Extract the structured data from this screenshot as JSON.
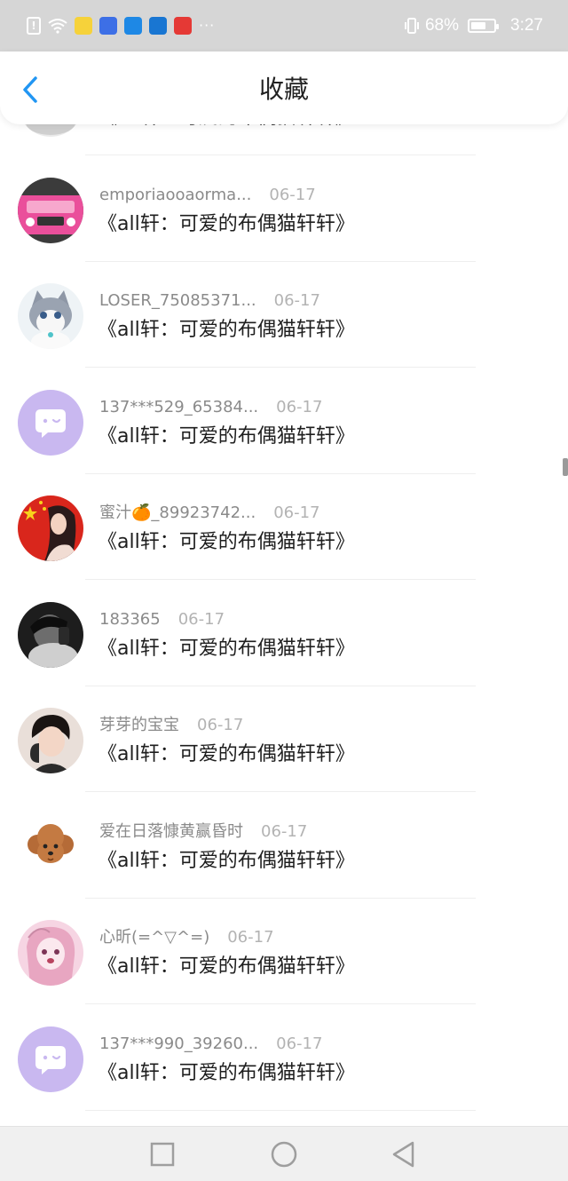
{
  "status_bar": {
    "battery_percent": "68%",
    "battery_level": 0.68,
    "time": "3:27",
    "more": "···",
    "icons": [
      "alert-icon",
      "wifi-icon",
      "app-icon-bee",
      "app-icon-baidu",
      "app-icon-quan",
      "app-icon-wifi-key",
      "app-icon-red",
      "vibrate-icon",
      "battery-icon"
    ]
  },
  "header": {
    "title": "收藏",
    "back_icon": "chevron-left-icon"
  },
  "items": [
    {
      "user": "",
      "date": "",
      "message": "《all轩：可爱的布偶猫轩轩》",
      "avatar": "partial-avatar"
    },
    {
      "user": "emporiaooaorma...",
      "date": "06-17",
      "message": "《all轩：可爱的布偶猫轩轩》",
      "avatar": "pink-car-avatar"
    },
    {
      "user": "LOSER_75085371...",
      "date": "06-17",
      "message": "《all轩：可爱的布偶猫轩轩》",
      "avatar": "cat-avatar"
    },
    {
      "user": "137***529_65384...",
      "date": "06-17",
      "message": "《all轩：可爱的布偶猫轩轩》",
      "avatar": "default-chat-avatar"
    },
    {
      "user": "蜜汁🍊_89923742...",
      "date": "06-17",
      "message": "《all轩：可爱的布偶猫轩轩》",
      "avatar": "flag-girl-avatar"
    },
    {
      "user": "183365",
      "date": "06-17",
      "message": "《all轩：可爱的布偶猫轩轩》",
      "avatar": "bw-photo-avatar"
    },
    {
      "user": "芽芽的宝宝",
      "date": "06-17",
      "message": "《all轩：可爱的布偶猫轩轩》",
      "avatar": "boy-headphones-avatar"
    },
    {
      "user": "爱在日落慷黄赢昏时",
      "date": "06-17",
      "message": "《all轩：可爱的布偶猫轩轩》",
      "avatar": "poodle-avatar"
    },
    {
      "user": "心昕(=^▽^=)",
      "date": "06-17",
      "message": "《all轩：可爱的布偶猫轩轩》",
      "avatar": "anime-girl-avatar"
    },
    {
      "user": "137***990_39260...",
      "date": "06-17",
      "message": "《all轩：可爱的布偶猫轩轩》",
      "avatar": "default-chat-avatar"
    }
  ],
  "navbar": {
    "icons": [
      "recent-apps-icon",
      "home-icon",
      "back-triangle-icon"
    ]
  },
  "colors": {
    "accent": "#2196f3",
    "default_avatar_bg": "#c9b8f0",
    "status_bar_bg": "#d6d6d6"
  }
}
